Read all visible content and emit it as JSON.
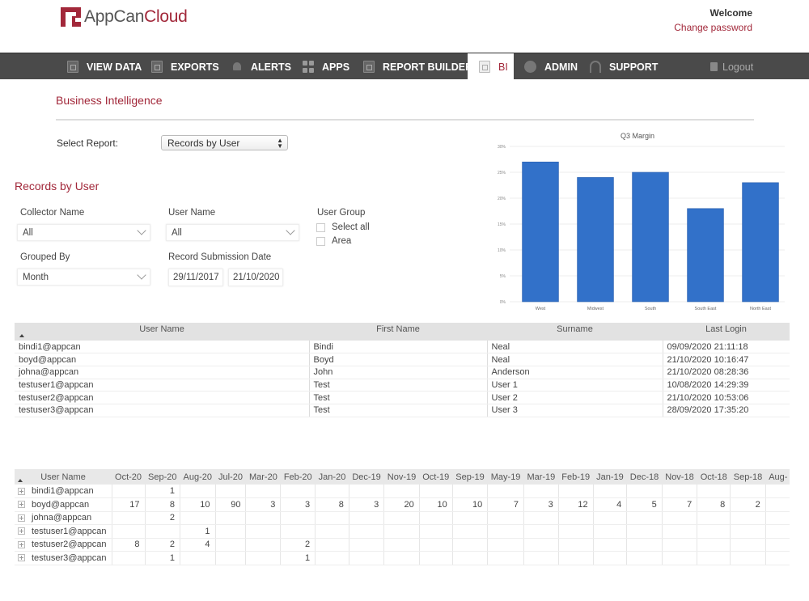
{
  "header": {
    "logo_part1": "AppCan",
    "logo_part2": "Cloud",
    "welcome": "Welcome",
    "change_password": "Change password"
  },
  "nav": {
    "items": [
      {
        "label": "VIEW DATA",
        "icon": "document-icon"
      },
      {
        "label": "EXPORTS",
        "icon": "export-icon"
      },
      {
        "label": "ALERTS",
        "icon": "bell-icon"
      },
      {
        "label": "APPS",
        "icon": "apps-grid-icon"
      },
      {
        "label": "REPORT BUILDER",
        "icon": "report-icon"
      },
      {
        "label": "BI",
        "icon": "chart-document-icon",
        "active": true
      },
      {
        "label": "ADMIN",
        "icon": "user-circle-icon"
      },
      {
        "label": "SUPPORT",
        "icon": "headset-icon"
      }
    ],
    "logout": "Logout"
  },
  "page": {
    "title": "Business Intelligence",
    "select_report_label": "Select Report:",
    "select_report_value": "Records by User",
    "section_title": "Records by User"
  },
  "filters": {
    "collector_name_label": "Collector Name",
    "collector_name_value": "All",
    "user_name_label": "User Name",
    "user_name_value": "All",
    "user_group_label": "User Group",
    "user_group_options": [
      "Select all",
      "Area"
    ],
    "grouped_by_label": "Grouped By",
    "grouped_by_value": "Month",
    "date_label": "Record Submission Date",
    "date_from": "29/11/2017",
    "date_to": "21/10/2020"
  },
  "chart_data": {
    "type": "bar",
    "title": "Q3 Margin",
    "categories": [
      "West",
      "Midwest",
      "South",
      "South East",
      "North East"
    ],
    "values": [
      27,
      24,
      25,
      18,
      23
    ],
    "yticks": [
      "0%",
      "5%",
      "10%",
      "15%",
      "20%",
      "25%",
      "30%"
    ],
    "ylim": [
      0,
      30
    ],
    "xlabel": "",
    "ylabel": "",
    "grid": true,
    "color": "#3271c9"
  },
  "users_table": {
    "columns": [
      "User Name",
      "First Name",
      "Surname",
      "Last Login"
    ],
    "rows": [
      [
        "bindi1@appcan",
        "Bindi",
        "Neal",
        "09/09/2020 21:11:18"
      ],
      [
        "boyd@appcan",
        "Boyd",
        "Neal",
        "21/10/2020 10:16:47"
      ],
      [
        "johna@appcan",
        "John",
        "Anderson",
        "21/10/2020 08:28:36"
      ],
      [
        "testuser1@appcan",
        "Test",
        "User 1",
        "10/08/2020 14:29:39"
      ],
      [
        "testuser2@appcan",
        "Test",
        "User 2",
        "21/10/2020 10:53:06"
      ],
      [
        "testuser3@appcan",
        "Test",
        "User 3",
        "28/09/2020 17:35:20"
      ]
    ]
  },
  "pivot_table": {
    "user_col": "User Name",
    "months": [
      "Oct-20",
      "Sep-20",
      "Aug-20",
      "Jul-20",
      "Mar-20",
      "Feb-20",
      "Jan-20",
      "Dec-19",
      "Nov-19",
      "Oct-19",
      "Sep-19",
      "May-19",
      "Mar-19",
      "Feb-19",
      "Jan-19",
      "Dec-18",
      "Nov-18",
      "Oct-18",
      "Sep-18",
      "Aug-"
    ],
    "rows": [
      {
        "user": "bindi1@appcan",
        "values": [
          "",
          "1",
          "",
          "",
          "",
          "",
          "",
          "",
          "",
          "",
          "",
          "",
          "",
          "",
          "",
          "",
          "",
          "",
          "",
          ""
        ]
      },
      {
        "user": "boyd@appcan",
        "values": [
          "17",
          "8",
          "10",
          "90",
          "3",
          "3",
          "8",
          "3",
          "20",
          "10",
          "10",
          "7",
          "3",
          "12",
          "4",
          "5",
          "7",
          "8",
          "2",
          ""
        ]
      },
      {
        "user": "johna@appcan",
        "values": [
          "",
          "2",
          "",
          "",
          "",
          "",
          "",
          "",
          "",
          "",
          "",
          "",
          "",
          "",
          "",
          "",
          "",
          "",
          "",
          ""
        ]
      },
      {
        "user": "testuser1@appcan",
        "values": [
          "",
          "",
          "1",
          "",
          "",
          "",
          "",
          "",
          "",
          "",
          "",
          "",
          "",
          "",
          "",
          "",
          "",
          "",
          "",
          ""
        ]
      },
      {
        "user": "testuser2@appcan",
        "values": [
          "8",
          "2",
          "4",
          "",
          "",
          "2",
          "",
          "",
          "",
          "",
          "",
          "",
          "",
          "",
          "",
          "",
          "",
          "",
          "",
          ""
        ]
      },
      {
        "user": "testuser3@appcan",
        "values": [
          "",
          "1",
          "",
          "",
          "",
          "1",
          "",
          "",
          "",
          "",
          "",
          "",
          "",
          "",
          "",
          "",
          "",
          "",
          "",
          ""
        ]
      }
    ]
  }
}
